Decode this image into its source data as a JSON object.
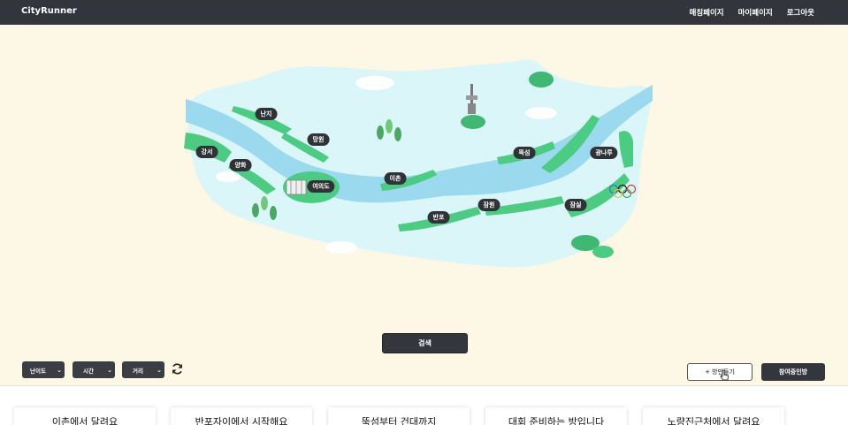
{
  "navbar": {
    "brand": "CityRunner",
    "links": [
      "매칭페이지",
      "마이페이지",
      "로그아웃"
    ]
  },
  "map": {
    "locations": [
      {
        "id": "nanji",
        "label": "난지"
      },
      {
        "id": "mangwon",
        "label": "망원"
      },
      {
        "id": "gangseo",
        "label": "강서"
      },
      {
        "id": "yanghwa",
        "label": "양화"
      },
      {
        "id": "yeouido",
        "label": "여의도"
      },
      {
        "id": "ichon",
        "label": "이촌"
      },
      {
        "id": "banpo",
        "label": "반포"
      },
      {
        "id": "jamwon",
        "label": "잠원"
      },
      {
        "id": "ttukseom",
        "label": "뚝섬"
      },
      {
        "id": "jamsil",
        "label": "잠실"
      },
      {
        "id": "gwangnaru",
        "label": "광나루"
      }
    ],
    "colors": {
      "river": "#9ad9ee",
      "land": "#dbf6f9",
      "park": "#4ccc82"
    }
  },
  "search_label": "검색",
  "filters": [
    {
      "id": "difficulty",
      "label": "난이도"
    },
    {
      "id": "time",
      "label": "시간"
    },
    {
      "id": "distance",
      "label": "거리"
    }
  ],
  "actions": {
    "new_room": "+ 방만들기",
    "joined_rooms": "참여중인방"
  },
  "rooms": [
    {
      "title": "이촌에서 달려요"
    },
    {
      "title": "반포자이에서 시작해요"
    },
    {
      "title": "뚝섬부터 건대까지"
    },
    {
      "title": "대회 준비하는 방입니다"
    },
    {
      "title": "노량진근처에서 달려요"
    }
  ]
}
